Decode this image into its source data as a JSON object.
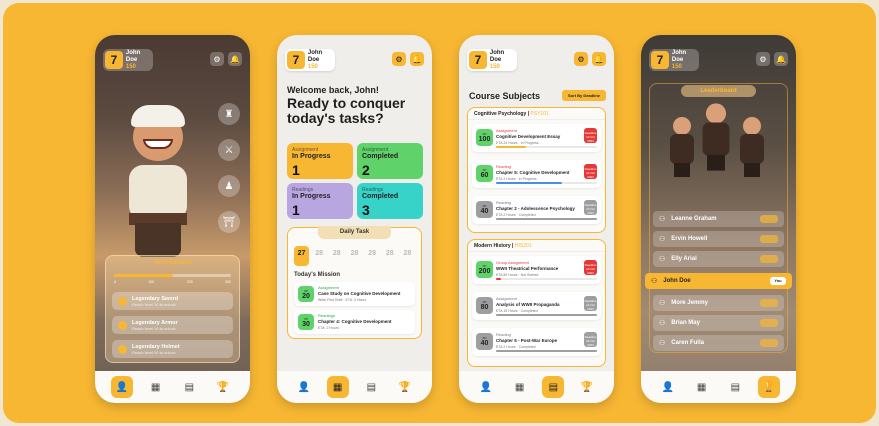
{
  "colors": {
    "accent": "#f7b733",
    "danger": "#e53935",
    "success": "#2ea84a",
    "purple": "#b8a6e0",
    "teal": "#37d3c8",
    "gray": "#9e9e9e"
  },
  "user": {
    "level": "7",
    "name": "John Doe",
    "points": "150"
  },
  "icons": {
    "settings": "gear-icon",
    "notifications": "bell-icon"
  },
  "nav": [
    "home-icon",
    "grid-icon",
    "clipboard-icon",
    "trophy-icon"
  ],
  "phone1": {
    "reward_title": "Next Reward",
    "progress_percent": 50,
    "milestones": [
      "0",
      "100",
      "200",
      "300"
    ],
    "rewards": [
      {
        "name": "Legendary Sword",
        "desc": "Reach level 10 to unlock"
      },
      {
        "name": "Legendary Armor",
        "desc": "Reach level 15 to unlock"
      },
      {
        "name": "Legendary Helmet",
        "desc": "Reach level 20 to unlock"
      }
    ]
  },
  "phone2": {
    "welcome": "Welcome back, John!",
    "headline": "Ready to conquer today's tasks?",
    "cards": [
      {
        "label": "Assignment",
        "status": "In Progress",
        "count": "1",
        "color": "#f7b733"
      },
      {
        "label": "Assignment",
        "status": "Completed",
        "count": "2",
        "color": "#5fd36a"
      },
      {
        "label": "Readings",
        "status": "In Progress",
        "count": "1",
        "color": "#b8a6e0"
      },
      {
        "label": "Readings",
        "status": "Completed",
        "count": "3",
        "color": "#37d3c8"
      }
    ],
    "daily_task": "Daily Task",
    "days": [
      "27",
      "28",
      "28",
      "28",
      "28",
      "28",
      "28"
    ],
    "mission_title": "Today's Mission",
    "missions": [
      {
        "xp": "20",
        "type": "Assignment",
        "title": "Case Study on Cognitive Development",
        "eta": "Write First Draft · ETA: 3 Hours",
        "color": "#5fd36a"
      },
      {
        "xp": "30",
        "type": "Readings",
        "title": "Chapter 4: Cognitive Development",
        "eta": "ETA: 2 Hours",
        "color": "#5fd36a"
      }
    ]
  },
  "phone3": {
    "title": "Course Subjects",
    "sort_label": "Sort By Deadline",
    "subjects": [
      {
        "name": "Cognitive Psychology",
        "code": "PSY101",
        "items": [
          {
            "xp": "100",
            "type": "Assignment",
            "title": "Cognitive Development Essay",
            "eta": "ETA 24 Hours · In Progress",
            "deadline": "Deadline 13 Oct 2023",
            "color": "#5fd36a",
            "deadline_color": "#e53935",
            "progress": 30,
            "bar_color": "#f7b733"
          },
          {
            "xp": "60",
            "type": "Reading",
            "title": "Chapter 5: Cognitive Development",
            "eta": "ETA 2 Hours · In Progress",
            "deadline": "Deadline 14 Oct 2023",
            "color": "#5fd36a",
            "deadline_color": "#e53935",
            "progress": 65,
            "bar_color": "#4a90e2"
          },
          {
            "xp": "40",
            "type": "Reading",
            "title": "Chapter 2 - Adolescence Psychology",
            "eta": "ETA 2 Hours · Completed",
            "deadline": "Deadline 10 Oct 2023",
            "color": "#9e9e9e",
            "deadline_color": "#9e9e9e",
            "progress": 100,
            "bar_color": "#9e9e9e"
          }
        ]
      },
      {
        "name": "Modern History",
        "code": "HIS201",
        "items": [
          {
            "xp": "200",
            "type": "Group Assignment",
            "title": "WWII Theatrical Performance",
            "eta": "ETA 80 Hours · Not Started",
            "deadline": "Deadline 15 Oct 2023",
            "color": "#5fd36a",
            "deadline_color": "#e53935",
            "progress": 5,
            "bar_color": "#e53935"
          },
          {
            "xp": "80",
            "type": "Assignment",
            "title": "Analysis of WWII Propaganda",
            "eta": "ETA 15 Hours · Completed",
            "deadline": "Deadline 12 Oct 2023",
            "color": "#9e9e9e",
            "deadline_color": "#9e9e9e",
            "progress": 100,
            "bar_color": "#9e9e9e"
          },
          {
            "xp": "40",
            "type": "Reading",
            "title": "Chapter 5 - Post-War Europe",
            "eta": "ETA 2 Hours · Completed",
            "deadline": "Deadline 09 Oct 2023",
            "color": "#9e9e9e",
            "deadline_color": "#9e9e9e",
            "progress": 100,
            "bar_color": "#9e9e9e"
          }
        ]
      }
    ]
  },
  "phone4": {
    "title": "Leaderboard",
    "players": [
      {
        "name": "Leanne Graham"
      },
      {
        "name": "Ervin Howell"
      },
      {
        "name": "Elly Arial"
      },
      {
        "name": "John Doe",
        "you": "You"
      },
      {
        "name": "More Jemmy"
      },
      {
        "name": "Brian May"
      },
      {
        "name": "Caren Fulla"
      }
    ]
  }
}
